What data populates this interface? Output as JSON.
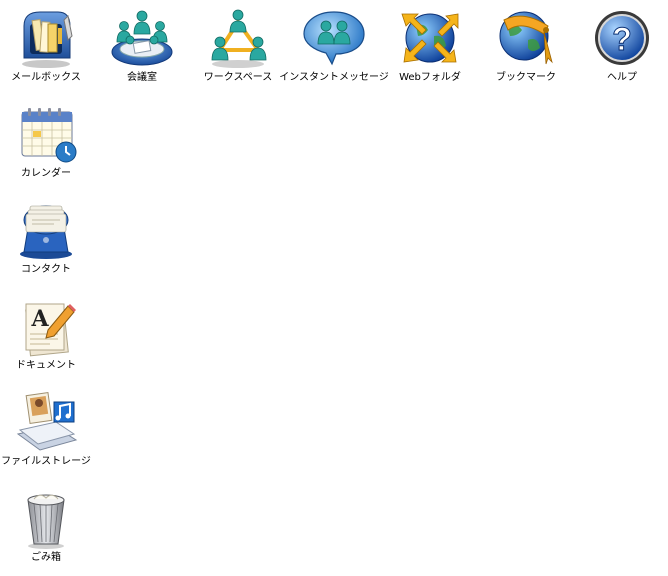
{
  "desktop": {
    "top_row": [
      {
        "label": "メールボックス",
        "icon": "mailbox-icon"
      },
      {
        "label": "会議室",
        "icon": "meeting-room-icon"
      },
      {
        "label": "ワークスペース",
        "icon": "workspace-icon"
      },
      {
        "label": "インスタントメッセージ",
        "icon": "instant-message-icon"
      },
      {
        "label": "Webフォルダ",
        "icon": "web-folder-icon"
      },
      {
        "label": "ブックマーク",
        "icon": "bookmark-icon"
      },
      {
        "label": "ヘルプ",
        "icon": "help-icon"
      }
    ],
    "left_column": [
      {
        "label": "カレンダー",
        "icon": "calendar-icon"
      },
      {
        "label": "コンタクト",
        "icon": "contact-rolodex-icon"
      },
      {
        "label": "ドキュメント",
        "icon": "document-icon"
      },
      {
        "label": "ファイルストレージ",
        "icon": "file-storage-icon"
      },
      {
        "label": "ごみ箱",
        "icon": "trash-icon"
      }
    ]
  }
}
